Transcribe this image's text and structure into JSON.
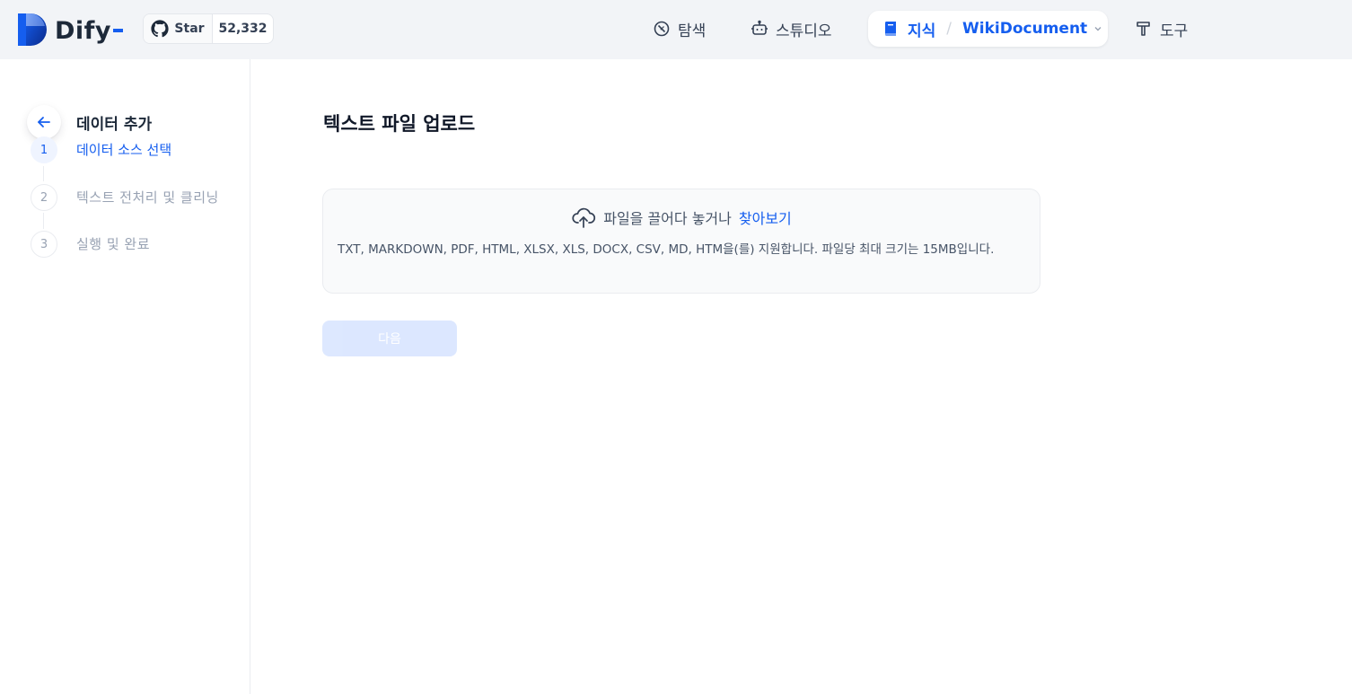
{
  "header": {
    "app_name": "Dify",
    "github": {
      "star_label": "Star",
      "count": "52,332"
    },
    "nav": {
      "explore": "탐색",
      "studio": "스튜디오",
      "knowledge": "지식",
      "separator": "/",
      "knowledge_doc": "WikiDocument",
      "tools": "도구"
    }
  },
  "sidebar": {
    "title": "데이터 추가",
    "steps": [
      {
        "number": "1",
        "label": "데이터 소스 선택",
        "state": "active"
      },
      {
        "number": "2",
        "label": "텍스트 전처리 및 클리닝",
        "state": "inactive"
      },
      {
        "number": "3",
        "label": "실행 및 완료",
        "state": "inactive"
      }
    ]
  },
  "main": {
    "title": "텍스트 파일 업로드",
    "dropzone": {
      "prompt": "파일을 끌어다 놓거나",
      "browse_link": "찾아보기",
      "note": "TXT, MARKDOWN, PDF, HTML, XLSX, XLS, DOCX, CSV, MD, HTM을(를) 지원합니다. 파일당 최대 크기는 15MB입니다."
    },
    "next_button": "다음"
  },
  "icons": {
    "logo": "dify-logo-icon",
    "github": "github-icon",
    "explore": "compass-icon",
    "studio": "robot-icon",
    "knowledge": "book-icon",
    "chevron": "chevron-down-icon",
    "tools": "hammer-icon",
    "back": "arrow-left-icon",
    "upload": "cloud-upload-icon"
  },
  "colors": {
    "accent": "#155eef",
    "header_bg": "#f2f4f7",
    "disabled_button": "#d1e0ff",
    "muted_text": "#98a2b3"
  }
}
